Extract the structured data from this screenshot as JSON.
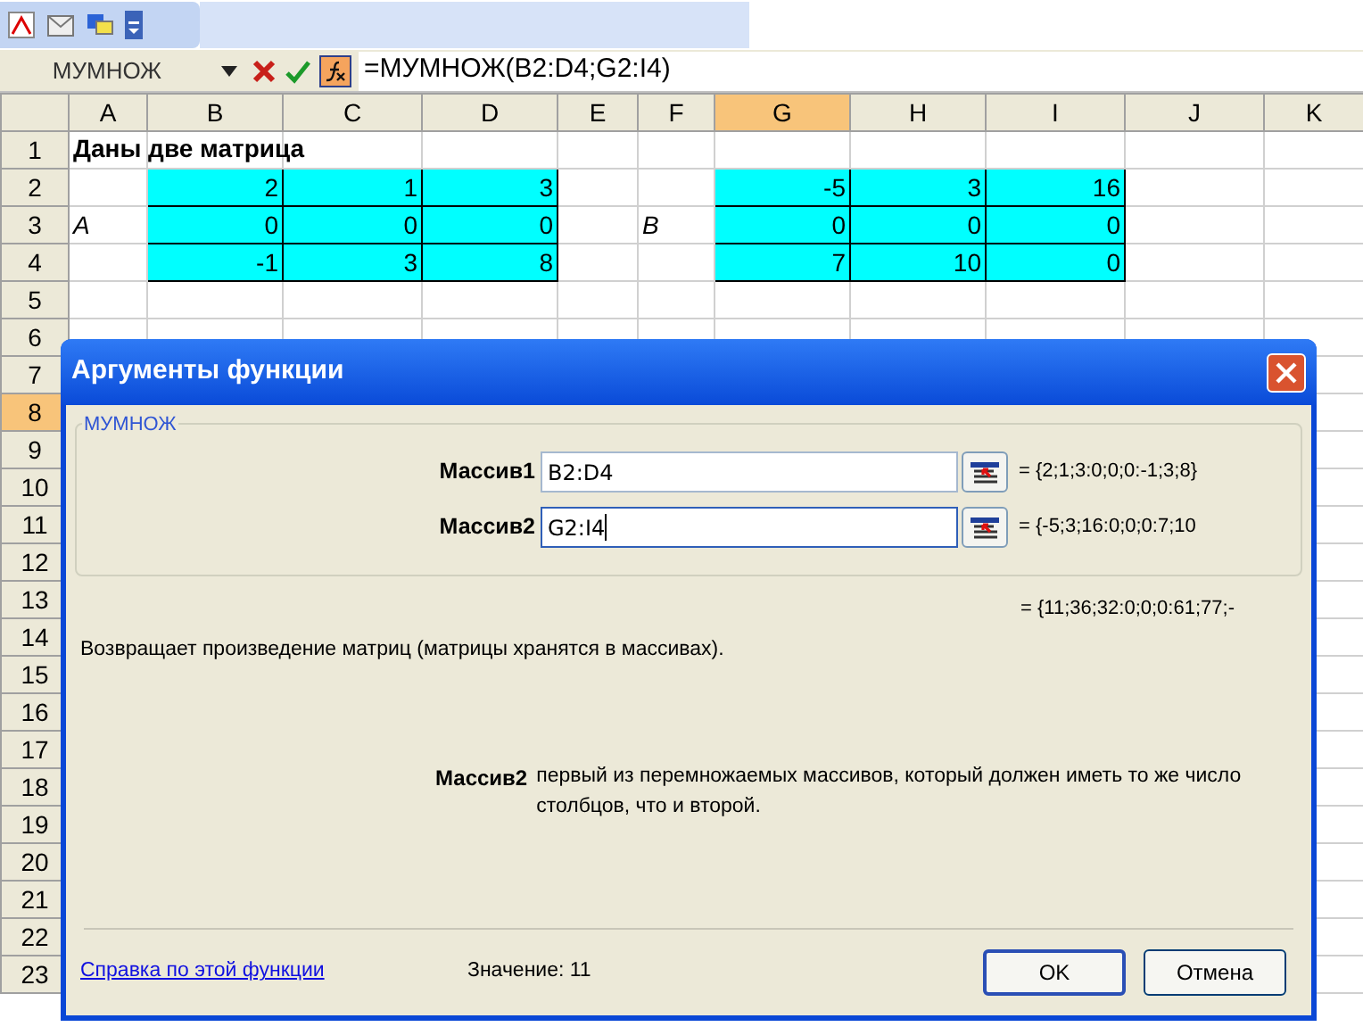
{
  "formula_bar": {
    "name_box": "МУМНОЖ",
    "formula": "=МУМНОЖ(B2:D4;G2:I4)"
  },
  "sheet": {
    "columns": [
      {
        "label": "A",
        "selected": false
      },
      {
        "label": "B",
        "selected": false
      },
      {
        "label": "C",
        "selected": false
      },
      {
        "label": "D",
        "selected": false
      },
      {
        "label": "E",
        "selected": false
      },
      {
        "label": "F",
        "selected": false
      },
      {
        "label": "G",
        "selected": true
      },
      {
        "label": "H",
        "selected": false
      },
      {
        "label": "I",
        "selected": false
      },
      {
        "label": "J",
        "selected": false
      },
      {
        "label": "K",
        "selected": false
      }
    ],
    "rows": [
      {
        "label": "1",
        "selected": false,
        "cells": [
          {
            "text": "Даны две матрица",
            "kind": "title"
          },
          null,
          null,
          null,
          null,
          null,
          null,
          null,
          null,
          null,
          null
        ]
      },
      {
        "label": "2",
        "selected": false,
        "cells": [
          null,
          {
            "text": "2",
            "kind": "number"
          },
          {
            "text": "1",
            "kind": "number"
          },
          {
            "text": "3",
            "kind": "number"
          },
          null,
          null,
          {
            "text": "-5",
            "kind": "number"
          },
          {
            "text": "3",
            "kind": "number"
          },
          {
            "text": "16",
            "kind": "number"
          },
          null,
          null
        ]
      },
      {
        "label": "3",
        "selected": false,
        "cells": [
          {
            "text": "A",
            "kind": "label"
          },
          {
            "text": "0",
            "kind": "number"
          },
          {
            "text": "0",
            "kind": "number"
          },
          {
            "text": "0",
            "kind": "number"
          },
          null,
          {
            "text": "B",
            "kind": "label"
          },
          {
            "text": "0",
            "kind": "number"
          },
          {
            "text": "0",
            "kind": "number"
          },
          {
            "text": "0",
            "kind": "number"
          },
          null,
          null
        ]
      },
      {
        "label": "4",
        "selected": false,
        "cells": [
          null,
          {
            "text": "-1",
            "kind": "number"
          },
          {
            "text": "3",
            "kind": "number"
          },
          {
            "text": "8",
            "kind": "number"
          },
          null,
          null,
          {
            "text": "7",
            "kind": "number"
          },
          {
            "text": "10",
            "kind": "number"
          },
          {
            "text": "0",
            "kind": "number"
          },
          null,
          null
        ]
      },
      {
        "label": "5",
        "selected": false
      },
      {
        "label": "6",
        "selected": false
      },
      {
        "label": "7",
        "selected": false
      },
      {
        "label": "8",
        "selected": true
      },
      {
        "label": "9",
        "selected": false
      },
      {
        "label": "10",
        "selected": false
      },
      {
        "label": "11",
        "selected": false
      },
      {
        "label": "12",
        "selected": false
      },
      {
        "label": "13",
        "selected": false
      },
      {
        "label": "14",
        "selected": false
      },
      {
        "label": "15",
        "selected": false
      },
      {
        "label": "16",
        "selected": false
      },
      {
        "label": "17",
        "selected": false
      },
      {
        "label": "18",
        "selected": false
      },
      {
        "label": "19",
        "selected": false
      },
      {
        "label": "20",
        "selected": false
      },
      {
        "label": "21",
        "selected": false
      },
      {
        "label": "22",
        "selected": false
      },
      {
        "label": "23",
        "selected": false
      }
    ]
  },
  "dialog": {
    "title": "Аргументы функции",
    "function_name": "МУМНОЖ",
    "arguments": [
      {
        "label": "Массив1",
        "value": "B2:D4",
        "result": "= {2;1;3:0;0;0:-1;3;8}",
        "focused": false
      },
      {
        "label": "Массив2",
        "value": "G2:I4",
        "result": "= {-5;3;16:0;0;0:7;10",
        "focused": true
      }
    ],
    "result": "= {11;36;32:0;0;0:61;77;-",
    "description": "Возвращает произведение матриц (матрицы хранятся в массивах).",
    "help": {
      "label": "Массив2",
      "text": "первый из перемножаемых массивов, который должен иметь то же число столбцов, что и второй."
    },
    "help_link": "Справка по этой функции",
    "value": "Значение: 11",
    "buttons": [
      "OK",
      "Отмена"
    ]
  }
}
